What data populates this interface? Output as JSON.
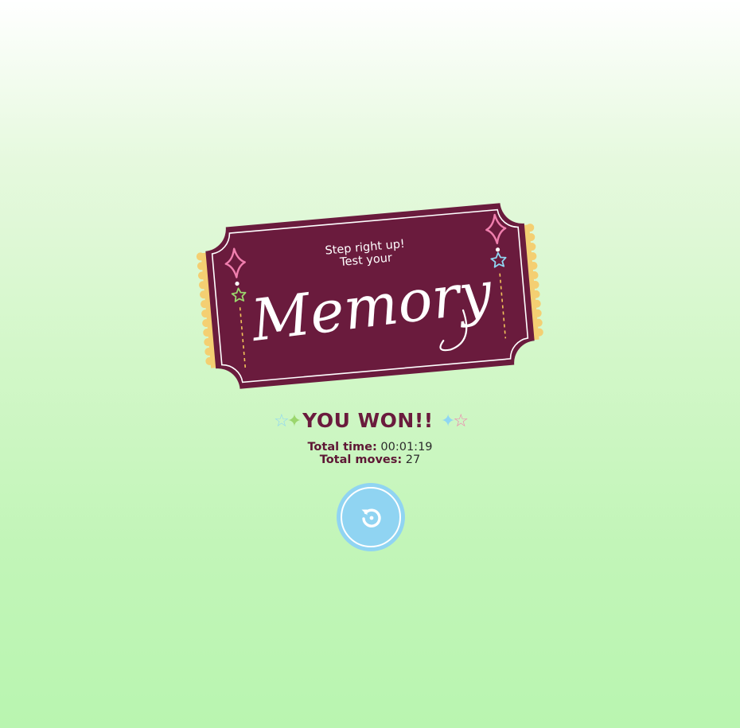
{
  "ticket": {
    "tagline_line1": "Step right up!",
    "tagline_line2": "Test your",
    "title": "Memory",
    "colors": {
      "body": "#6a1b3d",
      "edge": "#f4cf72",
      "pink": "#f07fae",
      "blue": "#8fd6f2",
      "green": "#9bd66d",
      "dots": "#f2c45a"
    }
  },
  "result": {
    "headline": "YOU WON!!",
    "deco_left": "☆✦",
    "deco_right": "✦☆",
    "time_label": "Total time:",
    "time_value": "00:01:19",
    "moves_label": "Total moves:",
    "moves_value": "27"
  },
  "controls": {
    "restart_icon": "restart-icon",
    "accent": "#90d4f2"
  }
}
